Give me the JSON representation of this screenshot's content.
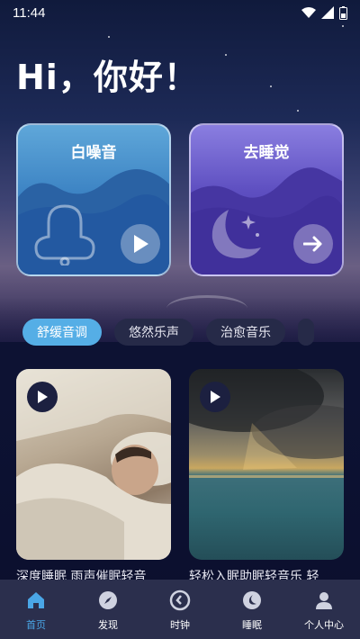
{
  "status_bar": {
    "time": "11:44"
  },
  "greeting": "Hi，你好！",
  "cards": [
    {
      "title": "白噪音",
      "button_icon": "play-icon",
      "color": "#3d84c4"
    },
    {
      "title": "去睡觉",
      "button_icon": "arrow-right-icon",
      "color": "#5d4ec0"
    }
  ],
  "tabs": [
    {
      "label": "舒缓音调",
      "active": true
    },
    {
      "label": "悠然乐声",
      "active": false
    },
    {
      "label": "治愈音乐",
      "active": false
    }
  ],
  "media": [
    {
      "caption": "深度睡眠 雨声催眠轻音"
    },
    {
      "caption": "轻松入眠助眠轻音乐 轻"
    }
  ],
  "nav": [
    {
      "label": "首页",
      "icon": "home-icon",
      "active": true
    },
    {
      "label": "发现",
      "icon": "compass-icon",
      "active": false
    },
    {
      "label": "时钟",
      "icon": "clock-icon",
      "active": false
    },
    {
      "label": "睡眠",
      "icon": "moon-icon",
      "active": false
    },
    {
      "label": "个人中心",
      "icon": "user-icon",
      "active": false
    }
  ],
  "colors": {
    "accent": "#4aa6e6",
    "nav_bg": "#2b2f4d",
    "tab_bg": "#262a48"
  }
}
